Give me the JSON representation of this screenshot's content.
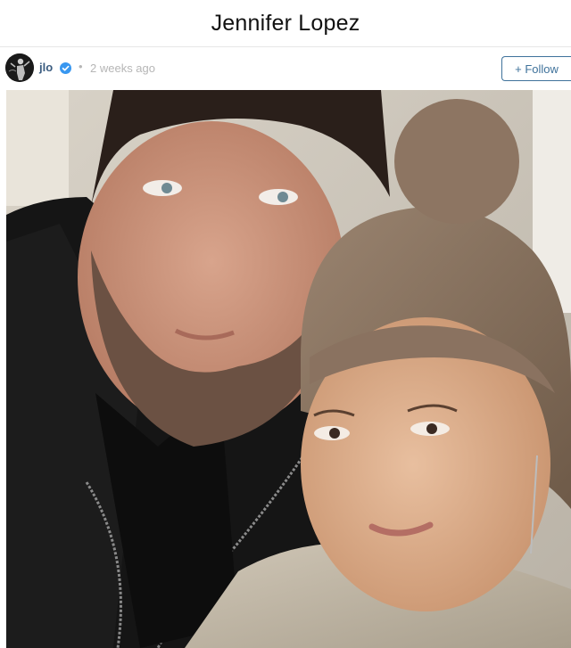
{
  "page": {
    "title": "Jennifer Lopez"
  },
  "post": {
    "username": "jlo",
    "verified_icon": "verified-badge-icon",
    "separator": "•",
    "timestamp": "2 weeks ago",
    "follow_label": "+ Follow",
    "photo_icon": "selfie-photo",
    "colors": {
      "username": "#3a5c80",
      "follow": "#3f729b",
      "verified": "#3897f0",
      "timestamp": "#b6b6b6"
    }
  }
}
